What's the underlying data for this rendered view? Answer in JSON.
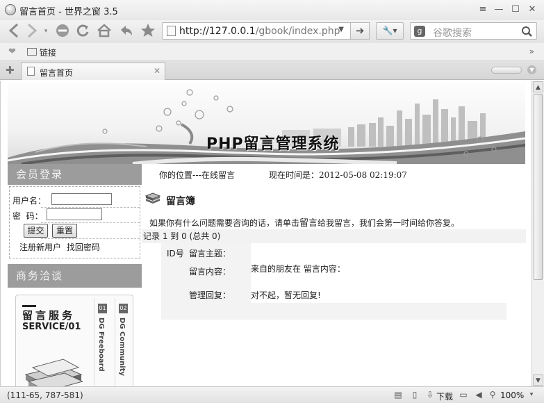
{
  "window": {
    "title": "留言首页 - 世界之窗 3.5",
    "controls": {
      "menu": "≡",
      "minimize": "—",
      "maximize": "☐",
      "close": "✕"
    }
  },
  "navbar": {
    "url_host": "http://127.0.0.1",
    "url_path": "/gbook/index.php",
    "search_placeholder": "谷歌搜索"
  },
  "bookmarks": {
    "folder_label": "链接",
    "more": "»"
  },
  "tabs": [
    {
      "label": "留言首页"
    }
  ],
  "page": {
    "banner_title": "PHP留言管理系统",
    "sidebar": {
      "login_heading": "会员登录",
      "username_label": "用户名：",
      "password_label": "密  码：",
      "submit_label": "提交",
      "reset_label": "重置",
      "register_link": "注册新用户",
      "recover_link": "找回密码",
      "business_heading": "商务洽谈",
      "service_title": "留言服务",
      "service_sub": "SERVICE/01",
      "col1": {
        "num": "01",
        "text": "DG Freeboard"
      },
      "col2": {
        "num": "02",
        "text": "DG Community"
      }
    },
    "location": "你的位置---在线留言",
    "now_label": "现在时间是：",
    "now_value": "2012-05-08 02:19:07",
    "guestbook_title": "留言簿",
    "intro_before": "如果你有什么问题需要咨询的话，请单击",
    "intro_link": "留言",
    "intro_after": "给我留言，我们会第一时间给你答复。",
    "records": "记录  1 到  0 (总共  0)",
    "message": {
      "id_label": "ID号",
      "subject_label": "留言主题：",
      "content_label": "留言内容：",
      "content_value": "来自的朋友在 留言内容：",
      "reply_label": "管理回复：",
      "reply_value": "对不起，暂无回复!"
    }
  },
  "statusbar": {
    "coords": "(111-65, 787-581)",
    "download": "下载",
    "zoom": "100%"
  }
}
